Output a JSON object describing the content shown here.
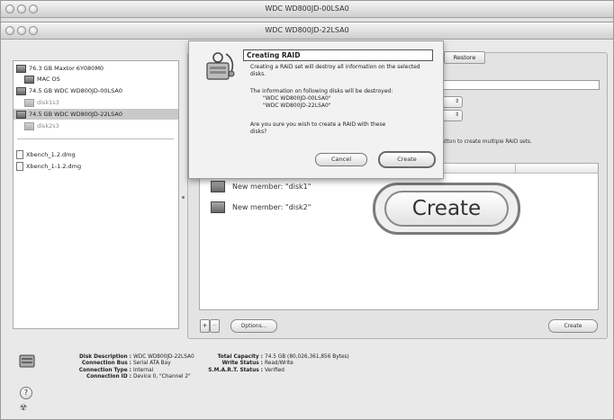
{
  "back_window": {
    "title": "WDC WD800JD-00LSA0"
  },
  "front_window": {
    "title": "WDC WD800JD-22LSA0"
  },
  "sidebar": {
    "items": [
      {
        "label": "76.3 GB Maxtor 6Y080M0",
        "kind": "drive"
      },
      {
        "label": "MAC OS",
        "kind": "volume"
      },
      {
        "label": "74.5 GB WDC WD800JD-00LSA0",
        "kind": "drive"
      },
      {
        "label": "disk1s3",
        "kind": "volume-dim"
      },
      {
        "label": "74.5 GB WDC WD800JD-22LSA0",
        "kind": "drive-selected"
      },
      {
        "label": "disk2s3",
        "kind": "volume-dim"
      },
      {
        "label": "Xbench_1.2.dmg",
        "kind": "dmg"
      },
      {
        "label": "Xbench_1-1.2.dmg",
        "kind": "dmg"
      }
    ]
  },
  "toolbar": {
    "restore_tab": "Restore"
  },
  "raid": {
    "hint_text": "button to create multiple RAID sets.",
    "members": [
      "New member: \"disk1\"",
      "New member: \"disk2\""
    ],
    "add_label": "+",
    "remove_label": "−",
    "options_label": "Options...",
    "create_label": "Create"
  },
  "dialog": {
    "title": "Creating RAID",
    "message": "Creating a RAID set will destroy all information on the selected disks.",
    "destroy_intro": "The information on following disks will be destroyed:",
    "disks": [
      "\"WDC WD800JD-00LSA0\"",
      "\"WDC WD800JD-22LSA0\""
    ],
    "question": "Are you sure you wish to create a RAID with these disks?",
    "cancel_label": "Cancel",
    "create_label": "Create"
  },
  "callout": {
    "label": "Create"
  },
  "info": {
    "left_labels": [
      "Disk Description :",
      "Connection Bus :",
      "Connection Type :",
      "Connection ID :"
    ],
    "left_values": [
      "WDC WD800JD-22LSA0",
      "Serial ATA Bay",
      "Internal",
      "Device 0, \"Channel 2\""
    ],
    "right_labels": [
      "Total Capacity :",
      "Write Status :",
      "S.M.A.R.T. Status :"
    ],
    "right_values": [
      "74.5 GB (80,026,361,856 Bytes)",
      "Read/Write",
      "Verified"
    ]
  },
  "icons": [
    "drive-icon",
    "dmg-icon",
    "raid-warning-icon",
    "help-icon",
    "burn-icon"
  ],
  "colors": {
    "selection": "#c9c9c9",
    "window_bg": "#e9e9e9",
    "list_bg": "#ffffff"
  }
}
